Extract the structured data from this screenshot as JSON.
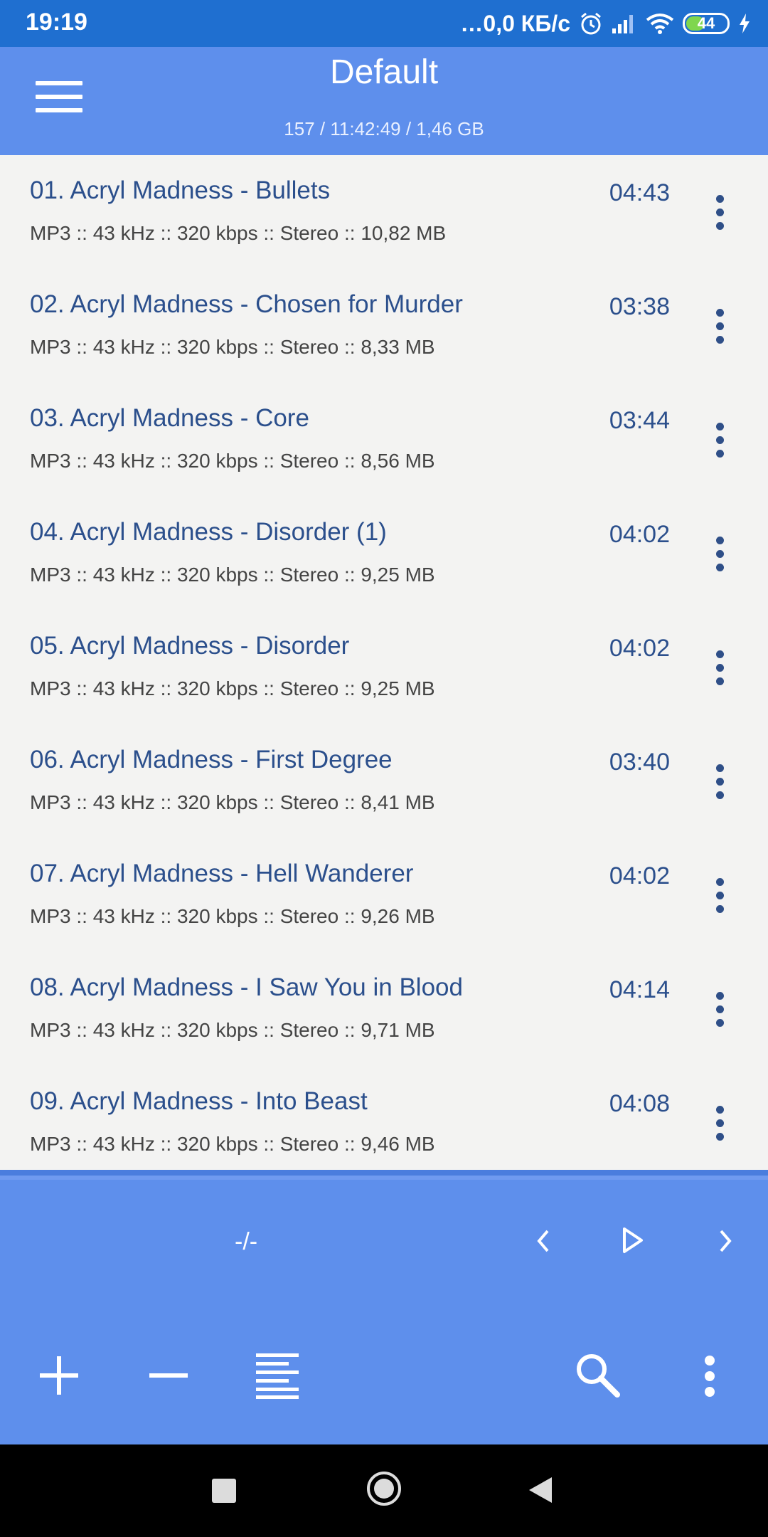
{
  "status_bar": {
    "time": "19:19",
    "net_speed": "…0,0 КБ/с",
    "battery": "44",
    "icons": [
      "alarm-icon",
      "signal-icon",
      "wifi-icon",
      "battery-icon",
      "charging-icon"
    ]
  },
  "header": {
    "title": "Default",
    "subtitle": "157 / 11:42:49 / 1,46 GB",
    "menu_icon": "hamburger-icon"
  },
  "tracks": [
    {
      "title": "01. Acryl Madness - Bullets",
      "meta": "MP3 :: 43 kHz :: 320 kbps :: Stereo :: 10,82 MB",
      "duration": "04:43"
    },
    {
      "title": "02. Acryl Madness - Chosen for Murder",
      "meta": "MP3 :: 43 kHz :: 320 kbps :: Stereo :: 8,33 MB",
      "duration": "03:38"
    },
    {
      "title": "03. Acryl Madness - Core",
      "meta": "MP3 :: 43 kHz :: 320 kbps :: Stereo :: 8,56 MB",
      "duration": "03:44"
    },
    {
      "title": "04. Acryl Madness - Disorder (1)",
      "meta": "MP3 :: 43 kHz :: 320 kbps :: Stereo :: 9,25 MB",
      "duration": "04:02"
    },
    {
      "title": "05. Acryl Madness - Disorder",
      "meta": "MP3 :: 43 kHz :: 320 kbps :: Stereo :: 9,25 MB",
      "duration": "04:02"
    },
    {
      "title": "06. Acryl Madness - First Degree",
      "meta": "MP3 :: 43 kHz :: 320 kbps :: Stereo :: 8,41 MB",
      "duration": "03:40"
    },
    {
      "title": "07. Acryl Madness - Hell Wanderer",
      "meta": "MP3 :: 43 kHz :: 320 kbps :: Stereo :: 9,26 MB",
      "duration": "04:02"
    },
    {
      "title": "08. Acryl Madness - I Saw You in Blood",
      "meta": "MP3 :: 43 kHz :: 320 kbps :: Stereo :: 9,71 MB",
      "duration": "04:14"
    },
    {
      "title": "09. Acryl Madness - Into Beast",
      "meta": "MP3 :: 43 kHz :: 320 kbps :: Stereo :: 9,46 MB",
      "duration": "04:08"
    }
  ],
  "player": {
    "position": "-/-",
    "controls": [
      "previous-icon",
      "play-icon",
      "next-icon"
    ]
  },
  "toolbar": {
    "buttons": [
      "add-icon",
      "remove-icon",
      "list-icon",
      "search-icon",
      "more-vertical-icon"
    ]
  },
  "colors": {
    "status_bar": "#1f6fd0",
    "accent": "#5e8fec",
    "list_bg": "#f3f3f2",
    "track_text": "#2b4f8c",
    "meta_text": "#444444",
    "nav_bar": "#000000"
  }
}
